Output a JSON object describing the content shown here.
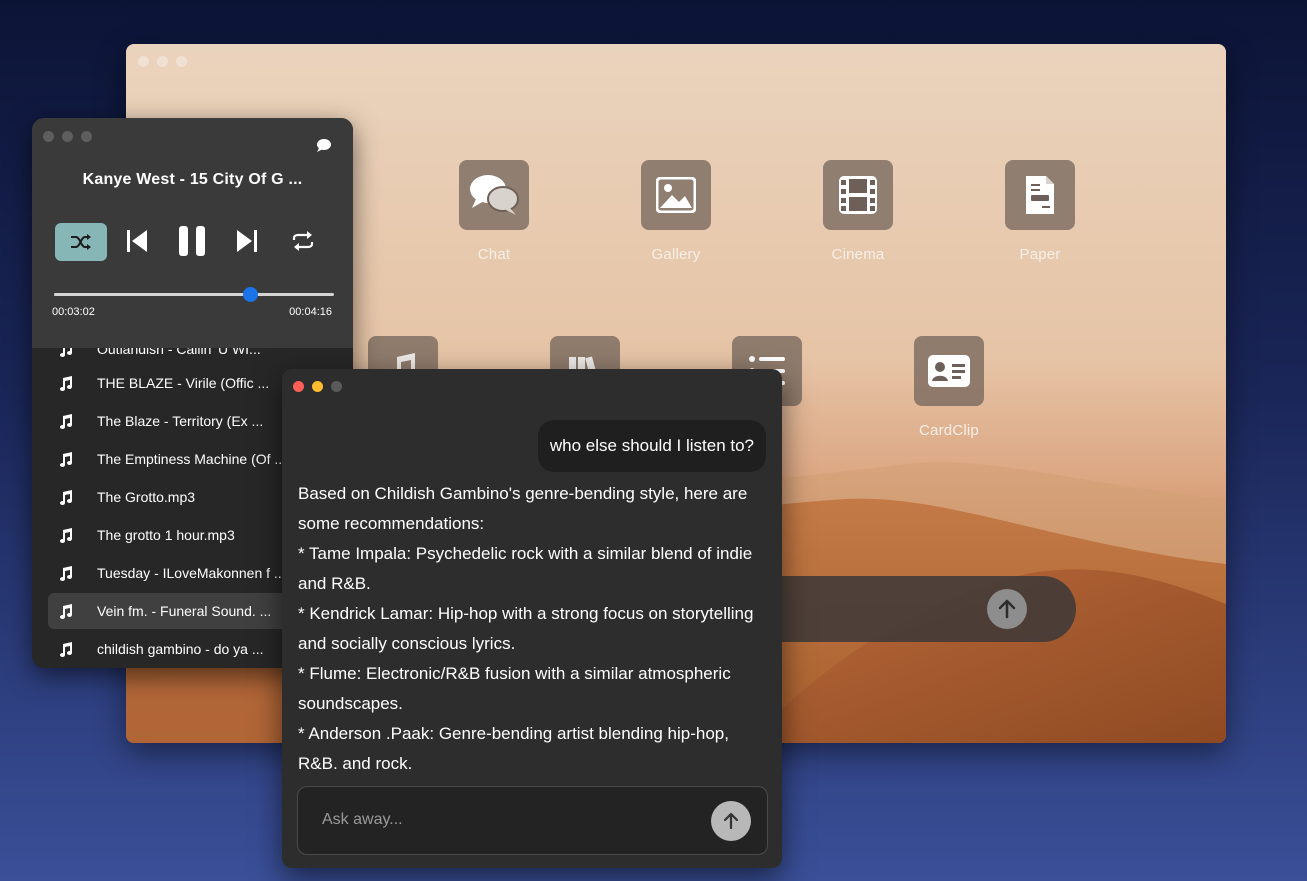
{
  "desktop": {
    "apps": [
      {
        "id": "chat",
        "label": "Chat",
        "icon": "chat-bubbles-icon"
      },
      {
        "id": "gallery",
        "label": "Gallery",
        "icon": "image-icon"
      },
      {
        "id": "cinema",
        "label": "Cinema",
        "icon": "film-icon"
      },
      {
        "id": "paper",
        "label": "Paper",
        "icon": "document-icon"
      },
      {
        "id": "music",
        "label": "",
        "icon": "music-note-icon"
      },
      {
        "id": "library",
        "label": "",
        "icon": "books-icon"
      },
      {
        "id": "list",
        "label": "",
        "icon": "list-icon"
      },
      {
        "id": "cardclip",
        "label": "CardClip",
        "icon": "contact-card-icon"
      }
    ]
  },
  "player": {
    "track_title": "Kanye West - 15 City Of G ...",
    "time_elapsed": "00:03:02",
    "time_total": "00:04:16",
    "progress": 0.7,
    "accent": "#86b7b6",
    "knob_color": "#1a73e8",
    "playlist": [
      {
        "label": "Outlandish - Callin' U WI..."
      },
      {
        "label": "THE BLAZE - Virile (Offic ..."
      },
      {
        "label": "The Blaze - Territory (Ex ..."
      },
      {
        "label": "The Emptiness Machine (Of ..."
      },
      {
        "label": "The Grotto.mp3"
      },
      {
        "label": "The grotto 1 hour.mp3"
      },
      {
        "label": "Tuesday - ILoveMakonnen f ..."
      },
      {
        "label": "Vein fm. - Funeral Sound. ..."
      },
      {
        "label": "childish gambino - do ya ..."
      }
    ],
    "active_index": 7
  },
  "chat": {
    "user_message": "who else should I listen to?",
    "assistant_lines": [
      "Based on Childish Gambino's genre-bending style, here are some recommendations:",
      "* Tame Impala: Psychedelic rock with a similar blend of indie and R&B.",
      "* Kendrick Lamar: Hip-hop with a strong focus on storytelling and socially conscious lyrics.",
      "* Flume: Electronic/R&B fusion with a similar atmospheric soundscapes.",
      "* Anderson .Paak: Genre-bending artist blending hip-hop, R&B, and rock."
    ],
    "input_placeholder": "Ask away...",
    "traffic_colors": [
      "#ff5f57",
      "#febc2e",
      "#5a5a5a"
    ]
  }
}
